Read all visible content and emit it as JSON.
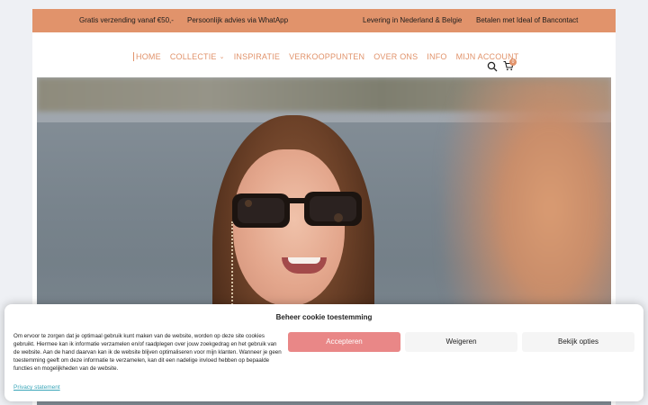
{
  "topbar": {
    "items": [
      "Gratis verzending vanaf €50,-",
      "Persoonlijk advies via WhatApp",
      "Levering in Nederland & Belgie",
      "Betalen met Ideal of Bancontact"
    ]
  },
  "nav": {
    "items": [
      {
        "label": "HOME"
      },
      {
        "label": "COLLECTIE"
      },
      {
        "label": "INSPIRATIE"
      },
      {
        "label": "VERKOOPPUNTEN"
      },
      {
        "label": "OVER ONS"
      },
      {
        "label": "INFO"
      },
      {
        "label": "MIJN ACCOUNT"
      }
    ],
    "cart_count": "0"
  },
  "colors": {
    "brand": "#e1936b",
    "accept": "#e98787",
    "link": "#3aa6b9"
  },
  "cookie": {
    "title": "Beheer cookie toestemming",
    "text": "Om ervoor te zorgen dat je optimaal gebruik kunt maken van de website, worden op deze site cookies gebruikt. Hiermee kan ik informatie verzamelen en/of raadplegen over jouw zoekgedrag en het gebruik van de website. Aan de hand daarvan kan ik de website blijven optimaliseren voor mijn klanten. Wanneer je geen toestemming geeft om deze informatie te verzamelen, kan dit een nadelige invloed hebben op bepaalde functies en mogelijkheden van de website.",
    "accept_label": "Accepteren",
    "deny_label": "Weigeren",
    "prefs_label": "Bekijk opties",
    "privacy_label": "Privacy statement"
  }
}
